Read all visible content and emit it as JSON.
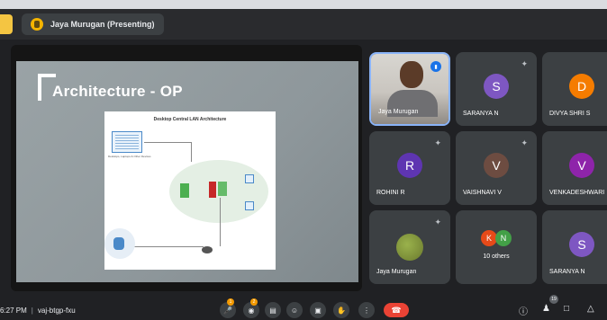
{
  "header": {
    "presenting_label": "Jaya Murugan (Presenting)"
  },
  "slide": {
    "title": "Architecture - OP",
    "diagram_title": "Desktop Central LAN Architecture",
    "client_caption": "Desktops, Laptops & Other Devices"
  },
  "participants": [
    {
      "name": "Jaya Murugan",
      "type": "video"
    },
    {
      "name": "SARANYA N",
      "initial": "S",
      "color": "#7e57c2"
    },
    {
      "name": "DIVYA SHRI S",
      "initial": "D",
      "color": "#f57c00"
    },
    {
      "name": "ROHINI R",
      "initial": "R",
      "color": "#5e35b1"
    },
    {
      "name": "VAISHNAVI V",
      "initial": "V",
      "color": "#6d4c41"
    },
    {
      "name": "VENKADESHWARI",
      "initial": "V",
      "color": "#8e24aa"
    },
    {
      "name": "Jaya Murugan",
      "type": "photo"
    },
    {
      "name": "10 others",
      "initials": [
        "K",
        "N"
      ],
      "colors": [
        "#e64a19",
        "#43a047"
      ]
    },
    {
      "name": "SARANYA N",
      "initial": "S",
      "color": "#7e57c2"
    }
  ],
  "bottom": {
    "time": "6:27 PM",
    "separator": "|",
    "meeting_code": "vaj-btgp-fxu",
    "badges": [
      "1",
      "2"
    ],
    "people_count": "19"
  }
}
